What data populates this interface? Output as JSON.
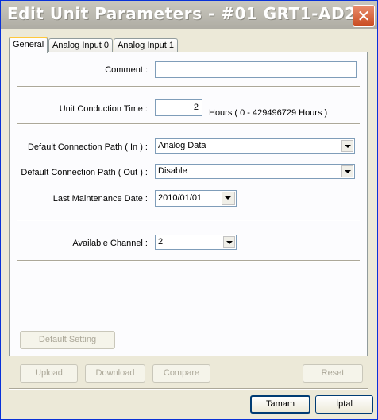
{
  "window": {
    "title": "Edit Unit Parameters - #01 GRT1-AD2",
    "close_glyph": "✕"
  },
  "tabs": [
    "General",
    "Analog Input 0",
    "Analog Input 1"
  ],
  "general": {
    "comment_label": "Comment :",
    "comment_value": "",
    "conduction_label": "Unit Conduction Time :",
    "conduction_value": "2",
    "conduction_range": "Hours ( 0 - 429496729 Hours )",
    "path_in_label": "Default Connection Path ( In ) :",
    "path_in_value": "Analog Data",
    "path_out_label": "Default Connection Path ( Out ) :",
    "path_out_value": "Disable",
    "maintenance_label": "Last Maintenance Date :",
    "maintenance_value": "2010/01/01",
    "channel_label": "Available Channel :",
    "channel_value": "2"
  },
  "buttons": {
    "default_setting": "Default Setting",
    "upload": "Upload",
    "download": "Download",
    "compare": "Compare",
    "reset": "Reset",
    "ok": "Tamam",
    "cancel": "İptal"
  }
}
